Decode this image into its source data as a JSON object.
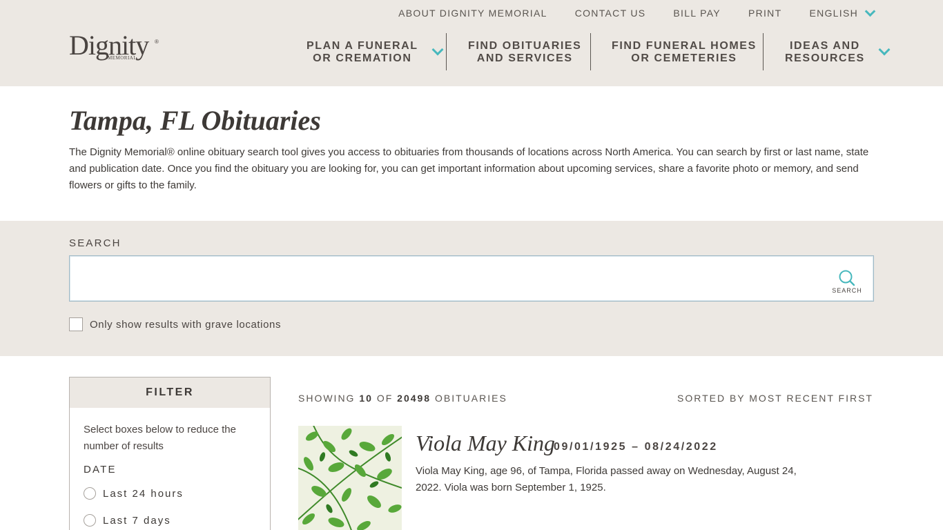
{
  "header": {
    "utility_links": [
      "ABOUT DIGNITY MEMORIAL",
      "CONTACT US",
      "BILL PAY",
      "PRINT"
    ],
    "language": "ENGLISH",
    "logo": {
      "word": "Dignity",
      "sub": "MEMORIAL",
      "reg": "®"
    },
    "nav": [
      {
        "line1": "PLAN A FUNERAL",
        "line2": "OR CREMATION",
        "has_dropdown": true
      },
      {
        "line1": "FIND OBITUARIES",
        "line2": "AND SERVICES",
        "has_dropdown": false
      },
      {
        "line1": "FIND FUNERAL HOMES",
        "line2": "OR CEMETERIES",
        "has_dropdown": false
      },
      {
        "line1": "IDEAS AND",
        "line2": "RESOURCES",
        "has_dropdown": true
      }
    ]
  },
  "intro": {
    "title": "Tampa, FL Obituaries",
    "description": "The Dignity Memorial® online obituary search tool gives you access to obituaries from thousands of locations across North America. You can search by first or last name, state and publication date. Once you find the obituary you are looking for, you can get important information about upcoming services, share a favorite photo or memory, and send flowers or gifts to the family."
  },
  "search": {
    "label": "SEARCH",
    "input_value": "",
    "button_label": "SEARCH",
    "grave_checkbox_label": "Only show results with grave locations",
    "grave_checked": false
  },
  "filter": {
    "heading": "FILTER",
    "hint": "Select boxes below to reduce the number of results",
    "date_heading": "DATE",
    "date_options": [
      "Last 24 hours",
      "Last 7 days"
    ]
  },
  "results": {
    "showing_prefix": "SHOWING",
    "shown_count": "10",
    "of_word": "OF",
    "total_count": "20498",
    "suffix": "OBITUARIES",
    "sort_label": "SORTED BY MOST RECENT FIRST",
    "items": [
      {
        "name": "Viola May King",
        "dates": "09/01/1925 – 08/24/2022",
        "summary": "Viola May King, age 96, of Tampa, Florida passed away on Wednesday, August 24, 2022. Viola was born September 1, 1925."
      }
    ]
  },
  "colors": {
    "band": "#ece8e3",
    "accent": "#47b8bd",
    "text": "#3d3936"
  }
}
